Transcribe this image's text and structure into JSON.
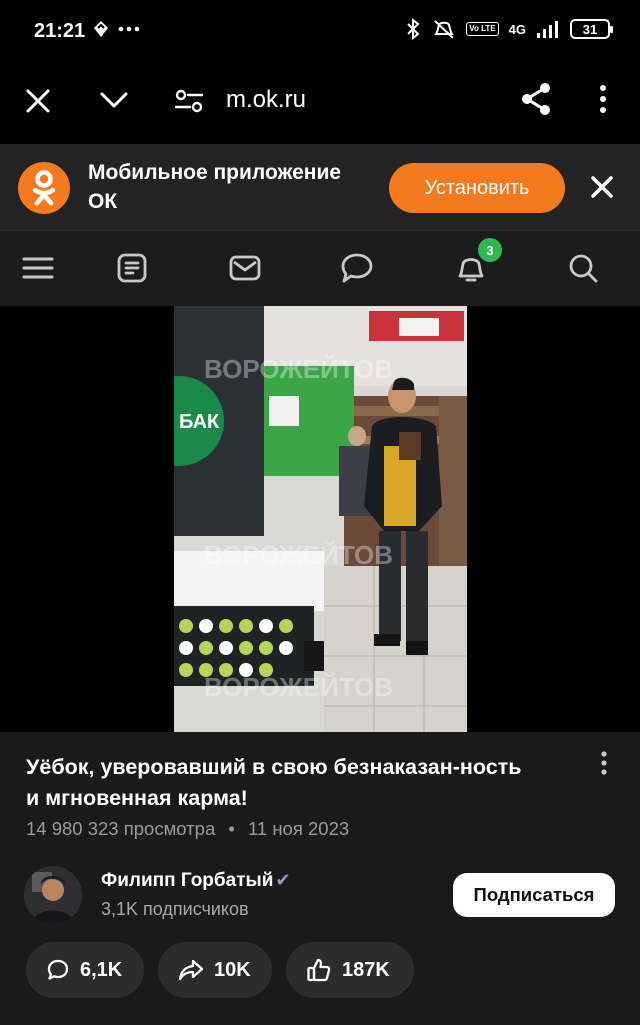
{
  "status_bar": {
    "time": "21:21",
    "network": "4G",
    "volte": "Vo LTE",
    "battery": "31"
  },
  "browser": {
    "url": "m.ok.ru"
  },
  "banner": {
    "text": "Мобильное приложение ОК",
    "install_label": "Установить",
    "accent_color": "#f47a20"
  },
  "nav": {
    "notification_count": "3",
    "badge_color": "#2fb84f",
    "items": [
      "menu-icon",
      "feed-icon",
      "mail-icon",
      "chat-icon",
      "bell-icon",
      "search-icon"
    ]
  },
  "video": {
    "watermark": "ВОРОЖЕЙТОВ",
    "store_sign": "БАК"
  },
  "post": {
    "title": "Уёбок, уверовавший в свою безнаказан-ность и мгновенная карма!",
    "views": "14 980 323 просмотра",
    "separator": "•",
    "date": "11 ноя 2023",
    "author": {
      "name": "Филипп Горбатый",
      "verified_mark": "✔",
      "subscribers": "3,1K подписчиков",
      "subscribe_label": "Подписаться"
    },
    "actions": {
      "comments": "6,1K",
      "shares": "10K",
      "likes": "187K"
    }
  }
}
